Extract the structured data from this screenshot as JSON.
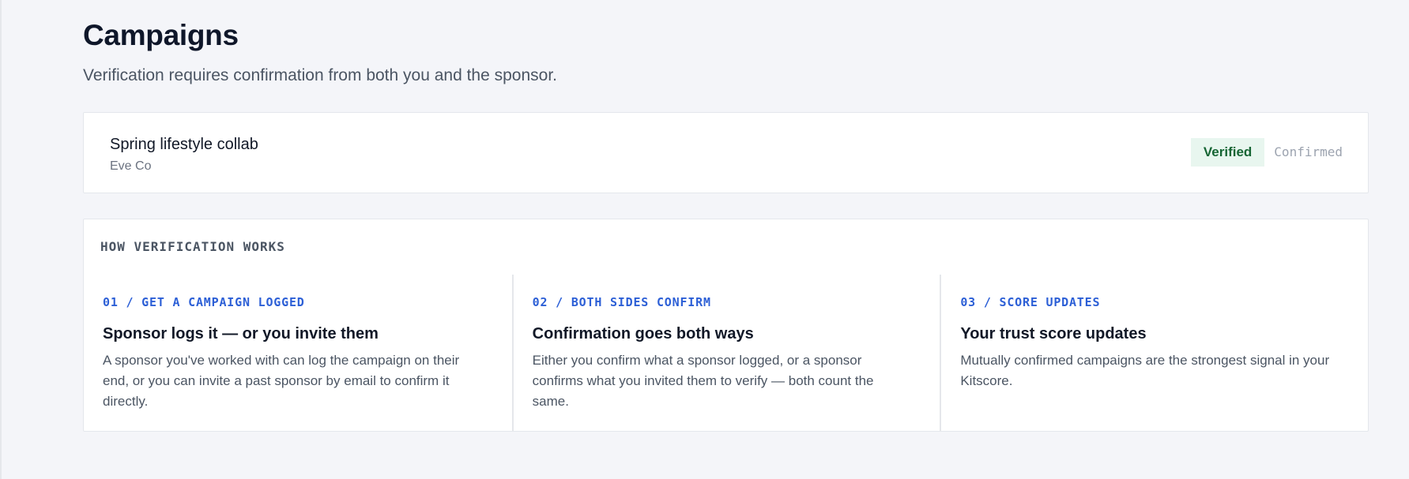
{
  "page": {
    "title": "Campaigns",
    "subtitle": "Verification requires confirmation from both you and the sponsor."
  },
  "campaigns": [
    {
      "title": "Spring lifestyle collab",
      "sponsor": "Eve Co",
      "status_badge": "Verified",
      "status_text": "Confirmed"
    }
  ],
  "how_it_works": {
    "heading": "HOW VERIFICATION WORKS",
    "steps": [
      {
        "label": "01 / GET A CAMPAIGN LOGGED",
        "title": "Sponsor logs it — or you invite them",
        "description": "A sponsor you've worked with can log the campaign on their end, or you can invite a past sponsor by email to confirm it directly."
      },
      {
        "label": "02 / BOTH SIDES CONFIRM",
        "title": "Confirmation goes both ways",
        "description": "Either you confirm what a sponsor logged, or a sponsor confirms what you invited them to verify — both count the same."
      },
      {
        "label": "03 / SCORE UPDATES",
        "title": "Your trust score updates",
        "description": "Mutually confirmed campaigns are the strongest signal in your Kitscore."
      }
    ]
  },
  "colors": {
    "background": "#f4f5f9",
    "card": "#ffffff",
    "accent_blue": "#2c5fd6",
    "verified_bg": "#e8f6ef",
    "verified_text": "#166534",
    "muted_text": "#6b7280"
  }
}
